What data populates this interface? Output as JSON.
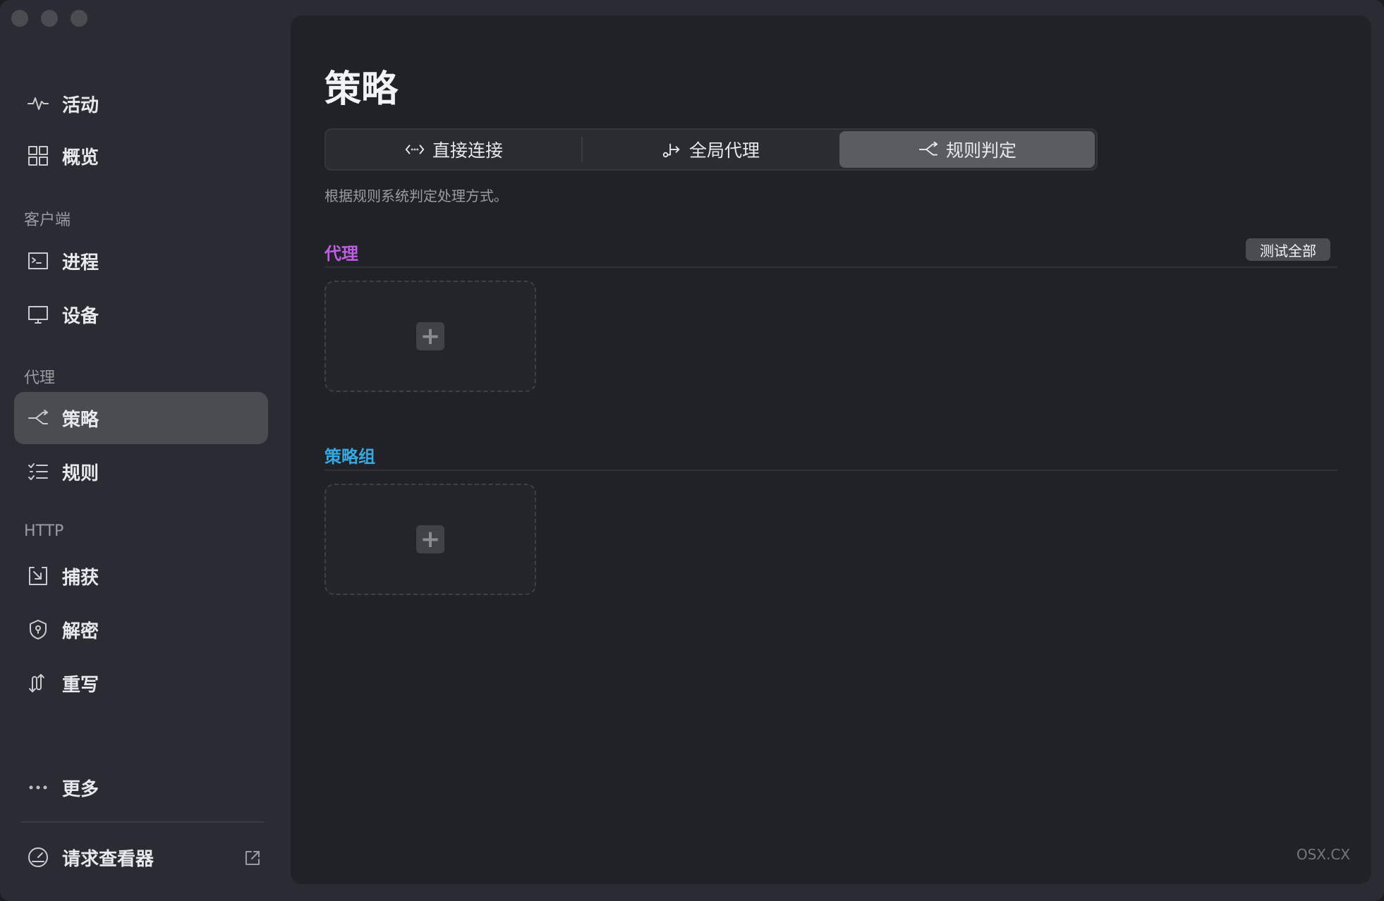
{
  "sidebar": {
    "items": {
      "activity": "活动",
      "overview": "概览",
      "process": "进程",
      "device": "设备",
      "policy": "策略",
      "rules": "规则",
      "capture": "捕获",
      "decrypt": "解密",
      "rewrite": "重写",
      "more": "更多",
      "request_viewer": "请求查看器"
    },
    "sections": {
      "client": "客户端",
      "proxy": "代理",
      "http": "HTTP"
    },
    "active_item": "策略"
  },
  "main": {
    "title": "策略",
    "modes": [
      "直接连接",
      "全局代理",
      "规则判定"
    ],
    "selected_mode": "规则判定",
    "description": "根据规则系统判定处理方式。",
    "proxy_section": {
      "title": "代理",
      "test_all_label": "测试全部",
      "add_label": "+"
    },
    "group_section": {
      "title": "策略组",
      "add_label": "+"
    },
    "accent_colors": {
      "proxy": "#c05ce6",
      "group": "#38a8e0"
    }
  },
  "watermark": "OSX.CX"
}
